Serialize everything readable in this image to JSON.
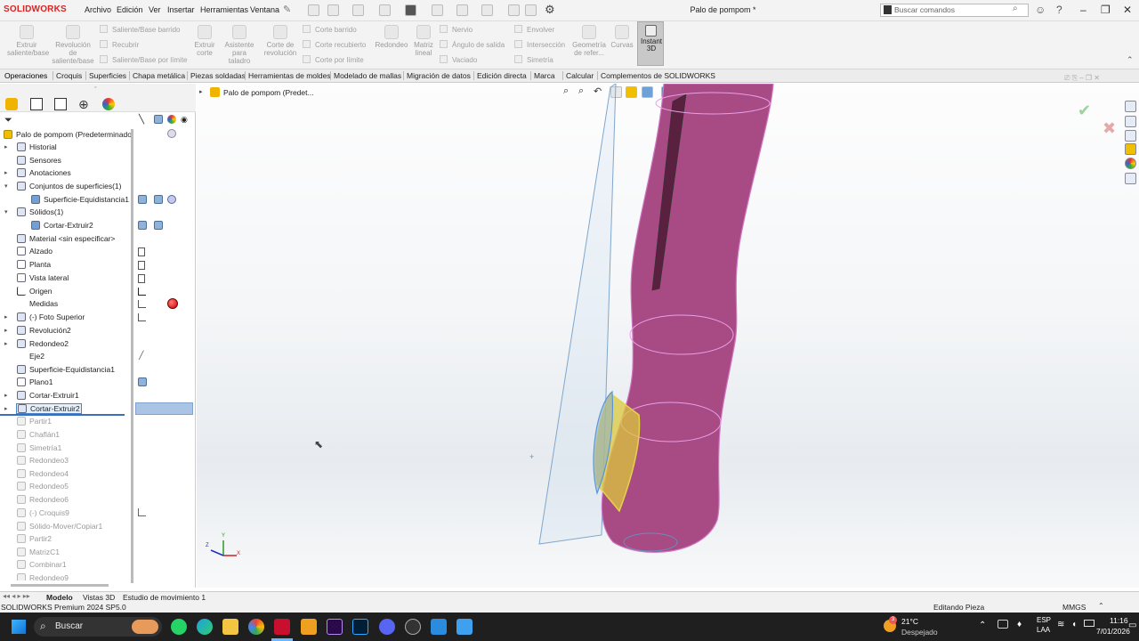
{
  "app": {
    "brand": "SOLIDWORKS",
    "document_title": "Palo de pompom *",
    "search_placeholder": "Buscar comandos",
    "menus": [
      "Archivo",
      "Edición",
      "Ver",
      "Insertar",
      "Herramientas",
      "Ventana"
    ]
  },
  "ribbon": {
    "big_buttons": [
      "Extruir saliente/base",
      "Revolución de saliente/base",
      "Extruir corte",
      "Asistente para taladro",
      "Corte de revolución",
      "Redondeo",
      "Matriz lineal",
      "Geometría de refer...",
      "Curvas",
      "Instant 3D"
    ],
    "small_buttons": [
      "Saliente/Base barrido",
      "Recubrir",
      "Saliente/Base por límite",
      "Corte barrido",
      "Corte recubierto",
      "Corte por límite",
      "Nervio",
      "Ángulo de salida",
      "Vaciado",
      "Envolver",
      "Intersección",
      "Simetría"
    ]
  },
  "tabs": [
    "Operaciones",
    "Croquis",
    "Superficies",
    "Chapa metálica",
    "Piezas soldadas",
    "Herramientas de moldes",
    "Modelado de mallas",
    "Migración de datos",
    "Edición directa",
    "Marca",
    "Calcular",
    "Complementos de SOLIDWORKS"
  ],
  "tree": {
    "root": "Palo de pompom (Predeterminado",
    "items": [
      "Historial",
      "Sensores",
      "Anotaciones",
      "Conjuntos de superficies(1)",
      "Superficie-Equidistancia1",
      "Sólidos(1)",
      "Cortar-Extruir2",
      "Material <sin especificar>",
      "Alzado",
      "Planta",
      "Vista lateral",
      "Origen",
      "Medidas",
      "(-) Foto Superior",
      "Revolución2",
      "Redondeo2",
      "Eje2",
      "Superficie-Equidistancia1",
      "Plano1",
      "Cortar-Extruir1",
      "Cortar-Extruir2"
    ],
    "dimmed": [
      "Partir1",
      "Chaflán1",
      "Simetría1",
      "Redondeo3",
      "Redondeo4",
      "Redondeo5",
      "Redondeo6",
      "(-) Croquis9",
      "Sólido-Mover/Copiar1",
      "Partir2",
      "MatrizC1",
      "Combinar1",
      "Redondeo9"
    ]
  },
  "viewport": {
    "breadcrumb": "Palo de pompom (Predet...",
    "axis_y": "Y",
    "axis_x": "X",
    "axis_z": "Z"
  },
  "bottom_tabs": [
    "Modelo",
    "Vistas 3D",
    "Estudio de movimiento 1"
  ],
  "status": {
    "version": "SOLIDWORKS Premium 2024 SP5.0",
    "mode": "Editando Pieza",
    "units": "MMGS"
  },
  "taskbar": {
    "search": "Buscar",
    "temperature": "21°C",
    "weather": "Despejado",
    "lang1": "ESP",
    "lang2": "LAA",
    "time": "11:16",
    "date": "7/01/2026",
    "badge": "3"
  }
}
